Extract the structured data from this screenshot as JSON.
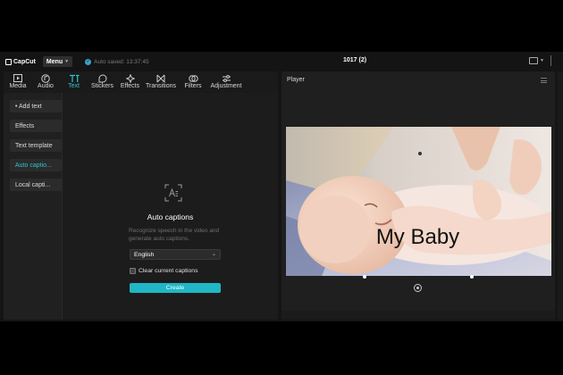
{
  "titlebar": {
    "app_name": "CapCut",
    "menu_label": "Menu",
    "autosave_text": "Auto saved: 13:37:45",
    "project_title": "1017 (2)"
  },
  "toolbar": {
    "items": [
      {
        "label": "Media",
        "icon": "media-icon"
      },
      {
        "label": "Audio",
        "icon": "audio-icon"
      },
      {
        "label": "Text",
        "icon": "text-icon",
        "active": true
      },
      {
        "label": "Stickers",
        "icon": "stickers-icon"
      },
      {
        "label": "Effects",
        "icon": "effects-icon"
      },
      {
        "label": "Transitions",
        "icon": "transitions-icon"
      },
      {
        "label": "Filters",
        "icon": "filters-icon"
      },
      {
        "label": "Adjustment",
        "icon": "adjustment-icon"
      }
    ]
  },
  "sidebar": {
    "items": [
      {
        "label": "• Add text"
      },
      {
        "label": "Effects"
      },
      {
        "label": "Text template"
      },
      {
        "label": "Auto captio...",
        "active": true
      },
      {
        "label": "Local capti..."
      }
    ]
  },
  "captions": {
    "title": "Auto captions",
    "description": "Recognize speech in the video and generate auto captions.",
    "language_value": "English",
    "clear_label": "Clear current captions",
    "create_label": "Create"
  },
  "player": {
    "title": "Player",
    "caption_text": "My Baby"
  },
  "colors": {
    "accent": "#2fc3d3",
    "create_button": "#1fb7c6",
    "panel_bg": "#1f1f1f"
  }
}
